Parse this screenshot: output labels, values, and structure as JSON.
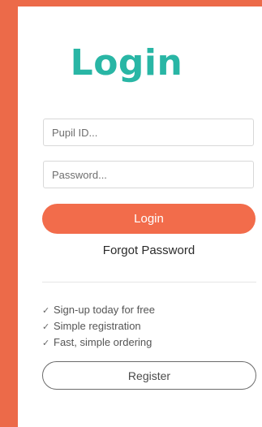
{
  "theme": {
    "background": "#ec6a49",
    "accent_title": "#29b6a5",
    "login_button": "#f26c4b"
  },
  "login_form": {
    "title": "Login",
    "pupil_id_placeholder": "Pupil ID...",
    "password_placeholder": "Password...",
    "login_button_label": "Login",
    "forgot_password_label": "Forgot Password"
  },
  "benefits": [
    {
      "icon": "check-icon",
      "text": "Sign-up today for free"
    },
    {
      "icon": "check-icon",
      "text": "Simple registration"
    },
    {
      "icon": "check-icon",
      "text": "Fast, simple ordering"
    }
  ],
  "register": {
    "button_label": "Register"
  }
}
